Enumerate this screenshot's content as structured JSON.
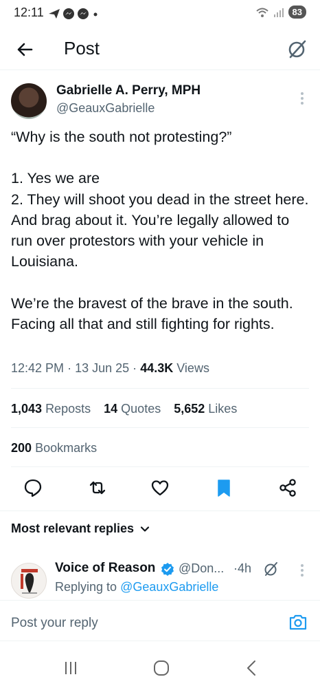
{
  "status_bar": {
    "time": "12:11",
    "battery": "83",
    "notification_icons": [
      "send-icon",
      "messenger-icon",
      "messenger-icon",
      "dot-icon"
    ]
  },
  "header": {
    "title": "Post"
  },
  "post": {
    "author_name": "Gabrielle A. Perry, MPH",
    "author_handle": "@GeauxGabrielle",
    "text": "“Why is the south not protesting?”\n\n1. Yes we are\n2. They will shoot you dead in the street here. And brag about it. You’re legally allowed to run over protestors with your vehicle in Louisiana.\n\nWe’re the bravest of the brave in the south. Facing all that and still fighting for rights.",
    "time": "12:42 PM",
    "date": "13 Jun 25",
    "views_count": "44.3K",
    "views_label": "Views",
    "separator": "·"
  },
  "stats": {
    "reposts_count": "1,043",
    "reposts_label": "Reposts",
    "quotes_count": "14",
    "quotes_label": "Quotes",
    "likes_count": "5,652",
    "likes_label": "Likes",
    "bookmarks_count": "200",
    "bookmarks_label": "Bookmarks"
  },
  "replies": {
    "sort_label": "Most relevant replies",
    "items": [
      {
        "name": "Voice of Reason",
        "handle": "@Don...",
        "time": "4h",
        "separator": "·",
        "replying_prefix": "Replying to",
        "replying_handle": "@GeauxGabrielle"
      }
    ]
  },
  "composer": {
    "placeholder": "Post your reply"
  },
  "colors": {
    "accent": "#1d9bf0",
    "text": "#0f1419",
    "secondary": "#536471",
    "divider": "#eff3f4"
  }
}
